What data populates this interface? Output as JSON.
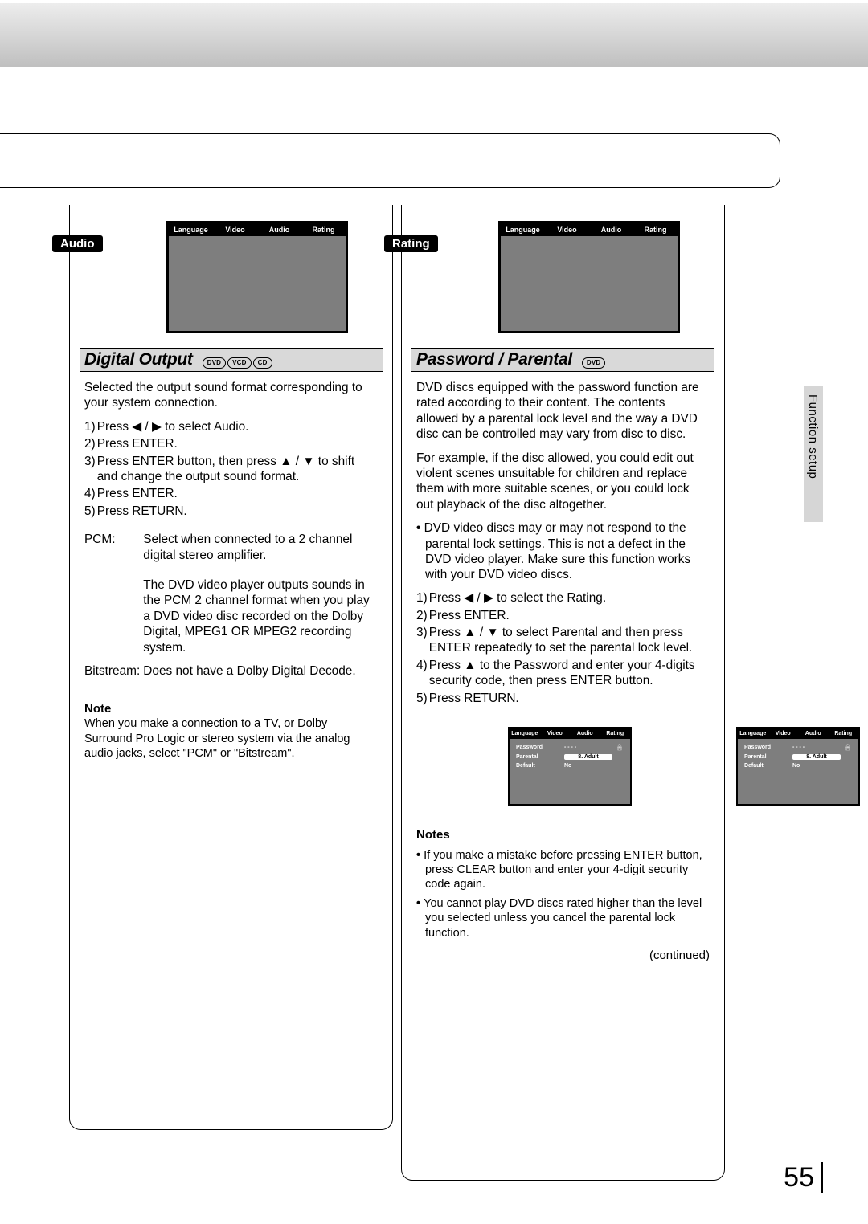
{
  "page_number": "55",
  "side_label": "Function setup",
  "osd_tabs": [
    "Language",
    "Video",
    "Audio",
    "Rating"
  ],
  "left": {
    "tag": "Audio",
    "section_title": "Digital Output",
    "discs": [
      "DVD",
      "VCD",
      "CD"
    ],
    "intro": "Selected the output sound format corresponding to your system connection.",
    "steps": [
      {
        "n": "1)",
        "t": "Press ◀ / ▶  to select Audio."
      },
      {
        "n": "2)",
        "t": "Press ENTER."
      },
      {
        "n": "3)",
        "t": "Press ENTER button, then press ▲ / ▼ to shift and change the output sound format."
      },
      {
        "n": "4)",
        "t": "Press ENTER."
      },
      {
        "n": "5)",
        "t": "Press RETURN."
      }
    ],
    "defs": [
      {
        "k": "PCM:",
        "v": "Select when connected to a 2 channel digital stereo amplifier."
      },
      {
        "gap": true,
        "v": "The DVD video player outputs sounds in the PCM 2 channel format when you play a DVD video disc recorded on the Dolby Digital, MPEG1 OR MPEG2 recording system."
      },
      {
        "k": "Bitstream:",
        "v": "Does not have a Dolby Digital Decode."
      }
    ],
    "note_h": "Note",
    "note_b": "When you make a connection to a TV, or Dolby Surround Pro Logic or stereo system via the analog audio jacks, select \"PCM\" or \"Bitstream\"."
  },
  "right": {
    "tag": "Rating",
    "section_title": "Password / Parental",
    "discs": [
      "DVD"
    ],
    "p1": "DVD discs equipped with the password function are rated according to their content. The contents allowed by a parental lock level and the way a DVD disc can be controlled may vary from disc to disc.",
    "p2": "For example, if the disc allowed, you could edit out violent scenes unsuitable for children and replace them with more suitable scenes, or you could lock out playback of the disc altogether.",
    "bullet1": "DVD video discs may or may not respond to the parental lock settings. This is not a defect in the DVD video player. Make sure this function works with your DVD video discs.",
    "steps": [
      {
        "n": "1)",
        "t": "Press ◀ / ▶  to select the Rating."
      },
      {
        "n": "2)",
        "t": "Press ENTER."
      },
      {
        "n": "3)",
        "t": "Press ▲ / ▼ to select Parental and then press ENTER repeatedly to set the parental lock level."
      },
      {
        "n": "4)",
        "t": "Press ▲ to the Password and enter your 4-digits security code, then press ENTER button."
      },
      {
        "n": "5)",
        "t": "Press RETURN."
      }
    ],
    "osd_rows": [
      {
        "k": "Password",
        "v": "- - - -",
        "lock": true
      },
      {
        "k": "Parental",
        "v": "8. Adult",
        "pill": true
      },
      {
        "k": "Default",
        "v": "No"
      }
    ],
    "notes_h": "Notes",
    "notes": [
      "If you make a mistake before pressing ENTER button, press CLEAR button and enter your 4-digit security code again.",
      "You cannot play DVD discs rated higher than the level you selected unless you cancel  the parental lock function."
    ],
    "continued": "(continued)"
  }
}
